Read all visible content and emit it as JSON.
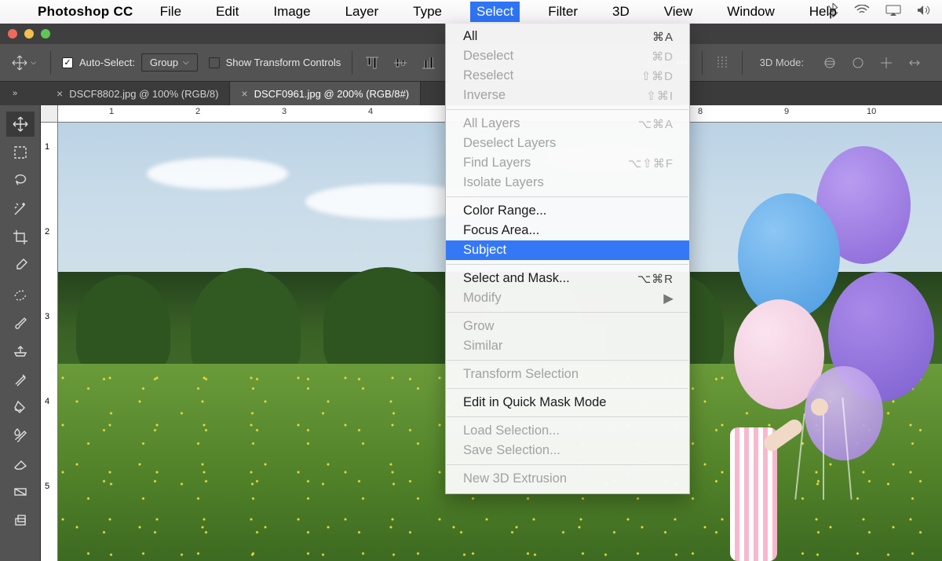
{
  "menubar": {
    "app": "Photoshop CC",
    "items": [
      "File",
      "Edit",
      "Image",
      "Layer",
      "Type",
      "Select",
      "Filter",
      "3D",
      "View",
      "Window",
      "Help"
    ],
    "active_index": 5
  },
  "options": {
    "auto_select": "Auto-Select:",
    "group": "Group",
    "show_transform": "Show Transform Controls",
    "mode3d": "3D Mode:"
  },
  "tabs": [
    {
      "label": "DSCF8802.jpg @ 100% (RGB/8)",
      "active": false
    },
    {
      "label": "DSCF0961.jpg @ 200% (RGB/8#)",
      "active": true
    }
  ],
  "ruler_h": [
    "1",
    "2",
    "3",
    "4",
    "8",
    "9",
    "10"
  ],
  "ruler_v": [
    "1",
    "2",
    "3",
    "4",
    "5"
  ],
  "tool_names": [
    "move-tool",
    "marquee-tool",
    "lasso-tool",
    "magic-wand-tool",
    "crop-tool",
    "eyedropper-tool",
    "healing-brush-tool",
    "brush-tool",
    "clone-stamp-tool",
    "history-brush-tool",
    "paint-bucket-tool",
    "blur-tool",
    "eraser-tool",
    "gradient-tool",
    "pen-tool"
  ],
  "dropdown": [
    {
      "t": "item",
      "label": "All",
      "shortcut": "⌘A"
    },
    {
      "t": "item",
      "label": "Deselect",
      "shortcut": "⌘D",
      "disabled": true
    },
    {
      "t": "item",
      "label": "Reselect",
      "shortcut": "⇧⌘D",
      "disabled": true
    },
    {
      "t": "item",
      "label": "Inverse",
      "shortcut": "⇧⌘I",
      "disabled": true
    },
    {
      "t": "sep"
    },
    {
      "t": "item",
      "label": "All Layers",
      "shortcut": "⌥⌘A",
      "disabled": true
    },
    {
      "t": "item",
      "label": "Deselect Layers",
      "disabled": true
    },
    {
      "t": "item",
      "label": "Find Layers",
      "shortcut": "⌥⇧⌘F",
      "disabled": true
    },
    {
      "t": "item",
      "label": "Isolate Layers",
      "disabled": true
    },
    {
      "t": "sep"
    },
    {
      "t": "item",
      "label": "Color Range..."
    },
    {
      "t": "item",
      "label": "Focus Area..."
    },
    {
      "t": "item",
      "label": "Subject",
      "highlight": true
    },
    {
      "t": "sep"
    },
    {
      "t": "item",
      "label": "Select and Mask...",
      "shortcut": "⌥⌘R"
    },
    {
      "t": "item",
      "label": "Modify",
      "submenu": true,
      "disabled": true
    },
    {
      "t": "sep"
    },
    {
      "t": "item",
      "label": "Grow",
      "disabled": true
    },
    {
      "t": "item",
      "label": "Similar",
      "disabled": true
    },
    {
      "t": "sep"
    },
    {
      "t": "item",
      "label": "Transform Selection",
      "disabled": true
    },
    {
      "t": "sep"
    },
    {
      "t": "item",
      "label": "Edit in Quick Mask Mode"
    },
    {
      "t": "sep"
    },
    {
      "t": "item",
      "label": "Load Selection...",
      "disabled": true
    },
    {
      "t": "item",
      "label": "Save Selection...",
      "disabled": true
    },
    {
      "t": "sep"
    },
    {
      "t": "item",
      "label": "New 3D Extrusion",
      "disabled": true
    }
  ]
}
